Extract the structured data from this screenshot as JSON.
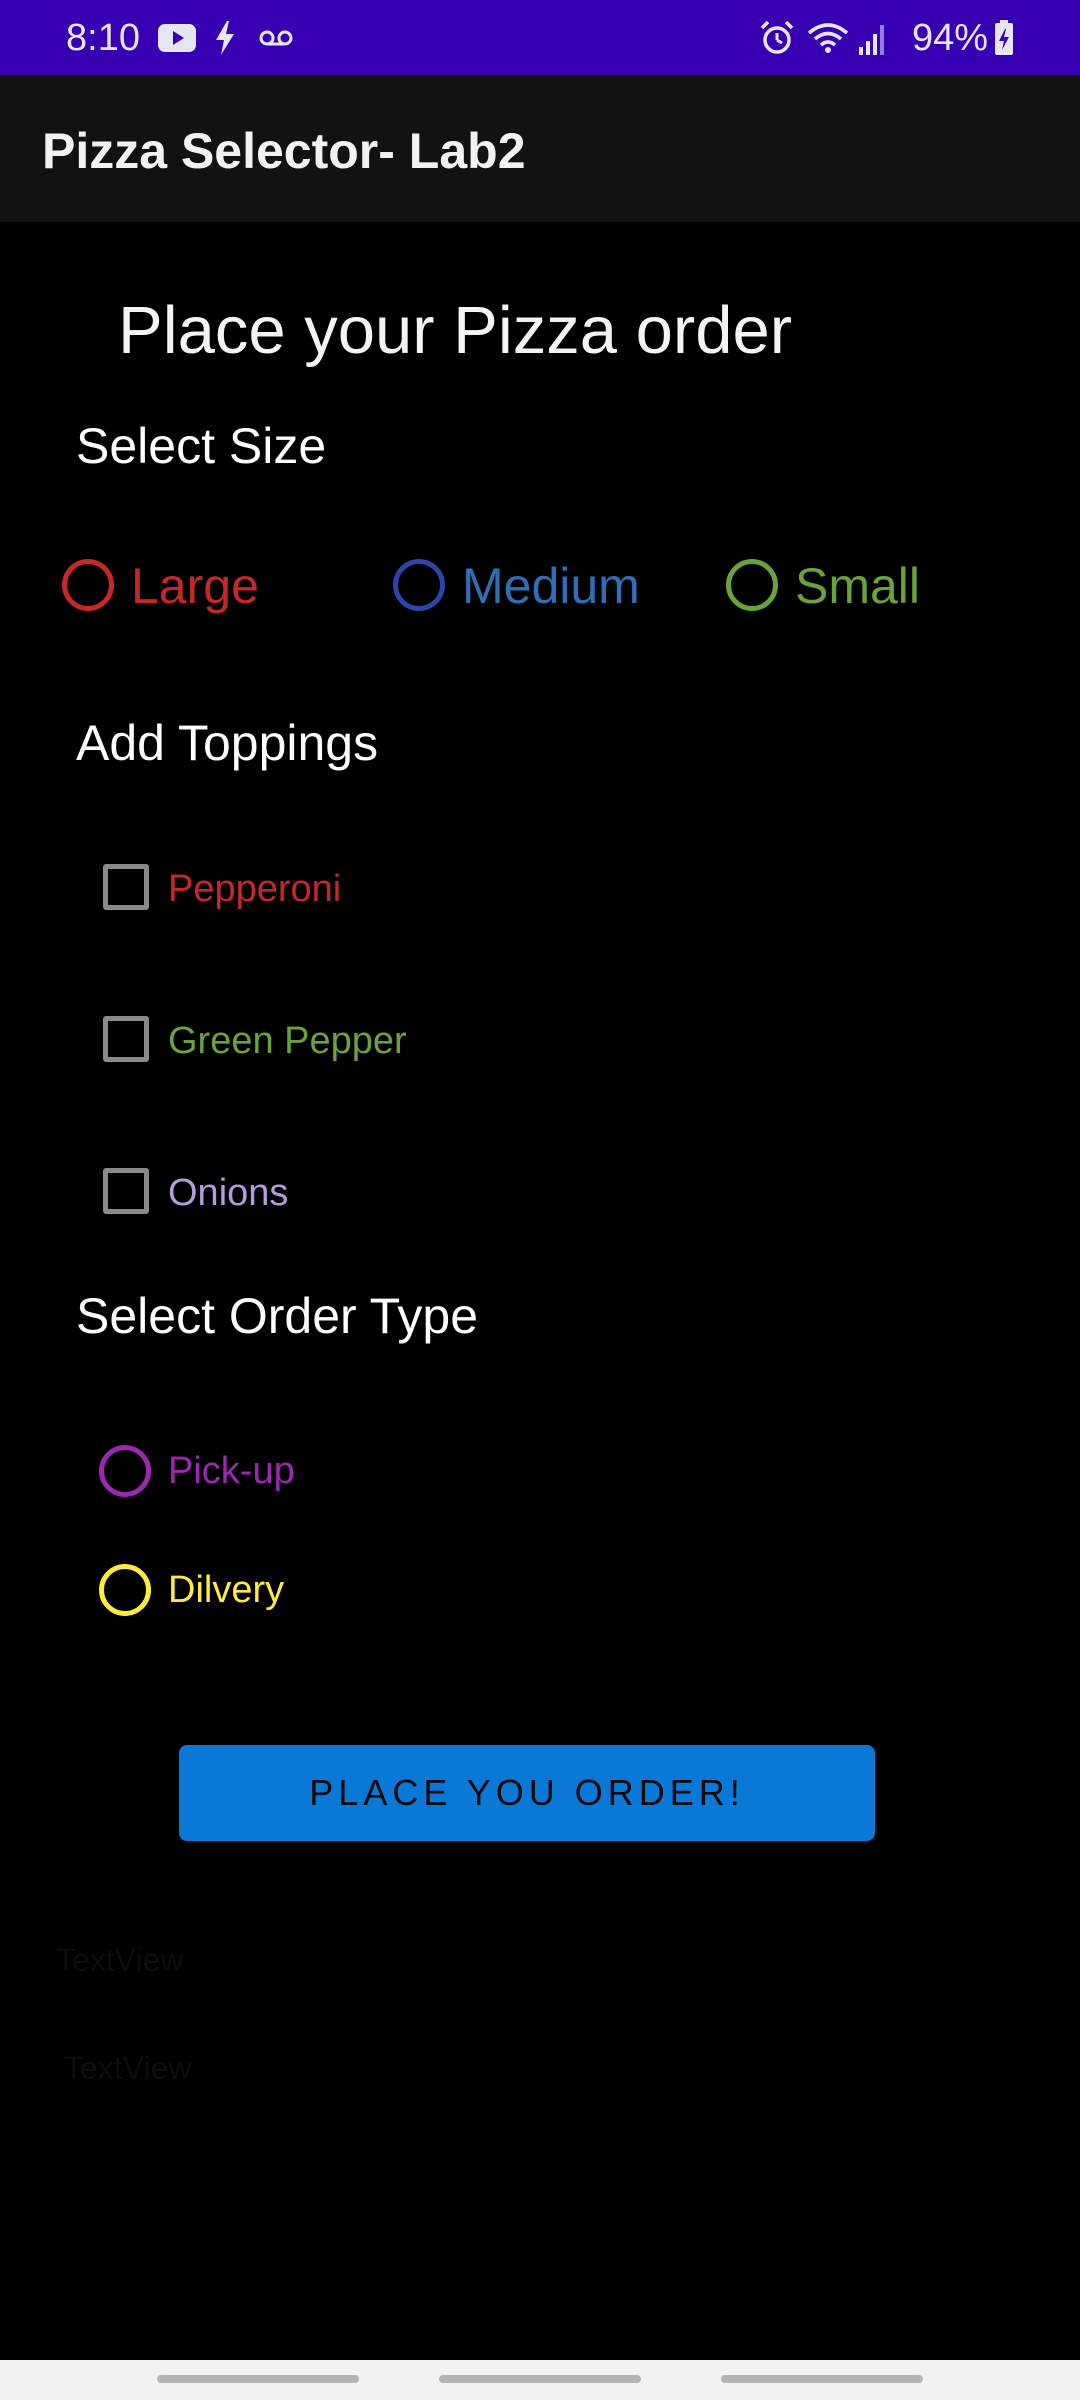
{
  "status_bar": {
    "time": "8:10",
    "battery": "94%",
    "icons": [
      "youtube-icon",
      "charging-bolt-icon",
      "voicemail-icon",
      "alarm-icon",
      "wifi-icon",
      "signal-icon",
      "battery-icon"
    ]
  },
  "app_bar": {
    "title": "Pizza Selector- Lab2"
  },
  "page": {
    "title": "Place your Pizza order",
    "size_heading": "Select Size",
    "toppings_heading": "Add Toppings",
    "order_type_heading": "Select Order Type"
  },
  "sizes": [
    {
      "label": "Large",
      "color": "#c62828"
    },
    {
      "label": "Medium",
      "color": "#3043a8"
    },
    {
      "label": "Small",
      "color": "#6aa33a"
    }
  ],
  "toppings": [
    {
      "label": "Pepperoni",
      "color": "#c62828"
    },
    {
      "label": "Green Pepper",
      "color": "#6aa33a"
    },
    {
      "label": "Onions",
      "color": "#b39ddb"
    }
  ],
  "order_types": [
    {
      "label": "Pick-up",
      "color": "#9c27b0"
    },
    {
      "label": "Dilvery",
      "color": "#ffeb3b"
    }
  ],
  "button": {
    "label": "PLACE YOU ORDER!",
    "color": "#0a78d6"
  },
  "results": {
    "line1": "TextView",
    "line2": "TextView"
  }
}
